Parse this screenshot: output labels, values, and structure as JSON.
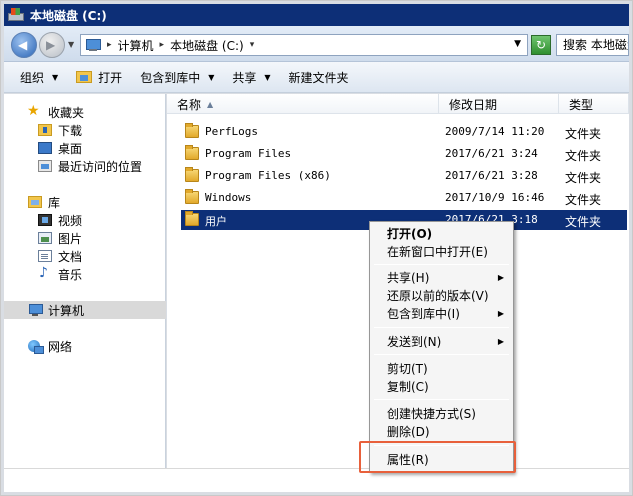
{
  "window": {
    "title": "本地磁盘 (C:)"
  },
  "address": {
    "crumbs": [
      "计算机",
      "本地磁盘 (C:)"
    ],
    "search_placeholder": "搜索 本地磁盘 (C:)"
  },
  "commands": {
    "organize": "组织",
    "open": "打开",
    "include_library": "包含到库中",
    "share": "共享",
    "new_folder": "新建文件夹"
  },
  "nav": {
    "favorites": "收藏夹",
    "downloads": "下载",
    "desktop": "桌面",
    "recent": "最近访问的位置",
    "libraries": "库",
    "videos": "视频",
    "pictures": "图片",
    "documents": "文档",
    "music": "音乐",
    "computer": "计算机",
    "network": "网络"
  },
  "columns": {
    "name": "名称",
    "date": "修改日期",
    "type": "类型"
  },
  "files": [
    {
      "name": "PerfLogs",
      "date": "2009/7/14 11:20",
      "type": "文件夹"
    },
    {
      "name": "Program Files",
      "date": "2017/6/21 3:24",
      "type": "文件夹"
    },
    {
      "name": "Program Files (x86)",
      "date": "2017/6/21 3:28",
      "type": "文件夹"
    },
    {
      "name": "Windows",
      "date": "2017/10/9 16:46",
      "type": "文件夹"
    },
    {
      "name": "用户",
      "date": "2017/6/21 3:18",
      "type": "文件夹"
    }
  ],
  "context_menu": {
    "open": "打开(O)",
    "open_new_window": "在新窗口中打开(E)",
    "share": "共享(H)",
    "restore_versions": "还原以前的版本(V)",
    "include_library": "包含到库中(I)",
    "send_to": "发送到(N)",
    "cut": "剪切(T)",
    "copy": "复制(C)",
    "create_shortcut": "创建快捷方式(S)",
    "delete": "删除(D)",
    "properties": "属性(R)"
  },
  "colors": {
    "selection": "#0d2f77",
    "highlight_box": "#e8603b"
  }
}
